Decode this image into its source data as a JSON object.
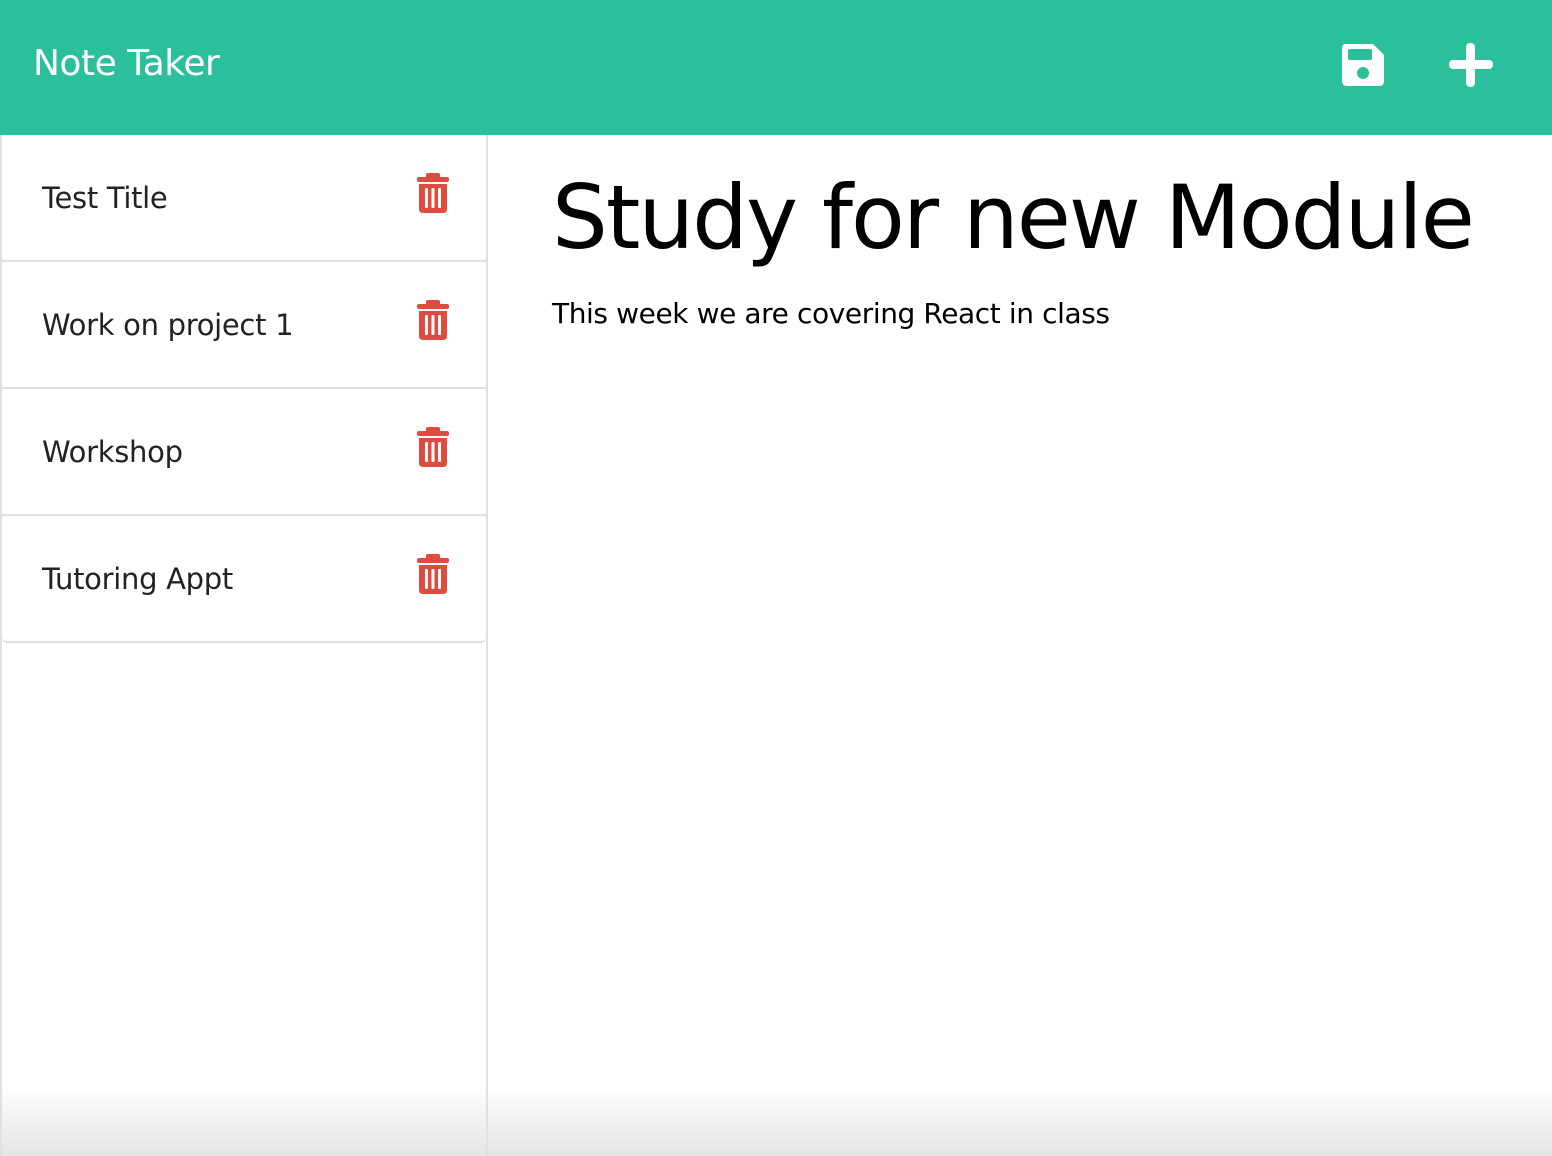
{
  "app": {
    "title": "Note Taker",
    "accent_color": "#2bbf9c",
    "danger_color": "#e04b3f"
  },
  "toolbar": {
    "save_icon": "floppy-disk-icon",
    "new_icon": "plus-icon"
  },
  "sidebar": {
    "delete_icon": "trash-icon",
    "notes": [
      {
        "title": "Test Title"
      },
      {
        "title": "Work on project 1"
      },
      {
        "title": "Workshop"
      },
      {
        "title": "Tutoring Appt"
      }
    ]
  },
  "active_note": {
    "title": "Study for new Module",
    "text": "This week we are covering React in class"
  }
}
